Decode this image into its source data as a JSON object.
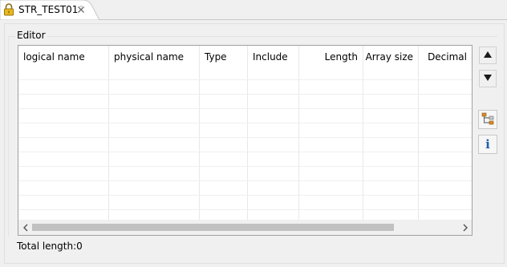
{
  "tab": {
    "title": "STR_TEST01",
    "lock_icon": "lock-icon",
    "close_icon": "close-icon"
  },
  "panel": {
    "label": "Editor"
  },
  "table": {
    "columns": [
      {
        "label": "logical name",
        "align": "left"
      },
      {
        "label": "physical name",
        "align": "left"
      },
      {
        "label": "Type",
        "align": "left"
      },
      {
        "label": "Include",
        "align": "left"
      },
      {
        "label": "Length",
        "align": "right"
      },
      {
        "label": "Array size",
        "align": "right"
      },
      {
        "label": "Decimal",
        "align": "right"
      }
    ],
    "rows": []
  },
  "scrollbar": {
    "left_icon": "chevron-left-icon",
    "right_icon": "chevron-right-icon"
  },
  "side_buttons": {
    "move_up_icon": "triangle-up-icon",
    "move_down_icon": "triangle-down-icon",
    "structure_icon": "hierarchy-icon",
    "info_icon": "info-icon",
    "info_glyph": "i"
  },
  "footer": {
    "total_length": "Total length:0"
  },
  "colors": {
    "background": "#f0f0f0",
    "info_blue": "#1f5fa8",
    "structure_orange": "#d88a2a"
  }
}
